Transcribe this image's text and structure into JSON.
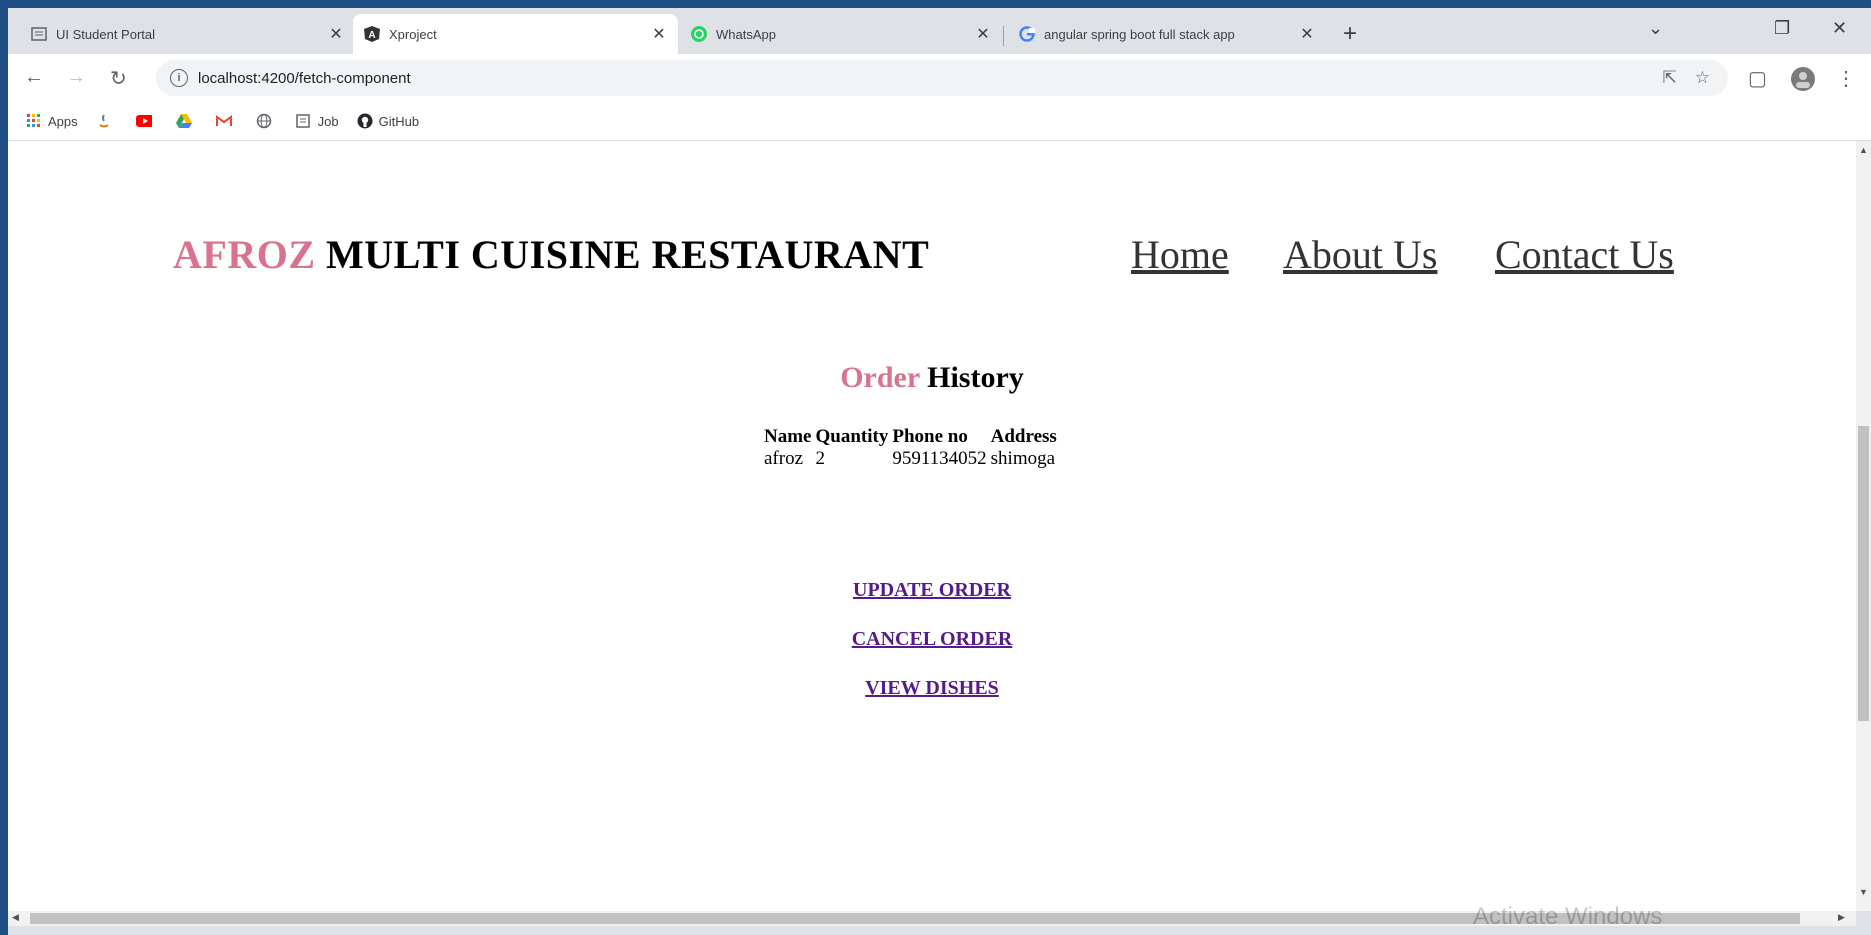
{
  "browser": {
    "tabs": [
      {
        "title": "UI Student Portal",
        "icon": "portal-icon"
      },
      {
        "title": "Xproject",
        "icon": "angular-icon"
      },
      {
        "title": "WhatsApp",
        "icon": "whatsapp-icon"
      },
      {
        "title": "angular spring boot full stack app",
        "icon": "google-icon"
      }
    ],
    "url": "localhost:4200/fetch-component",
    "bookmarks": [
      "Apps",
      "Job",
      "GitHub"
    ]
  },
  "site": {
    "brand_accent": "AFROZ",
    "brand_rest": " MULTI CUISINE RESTAURANT",
    "nav": [
      "Home",
      "About Us",
      "Contact Us"
    ]
  },
  "history": {
    "title_accent": "Order",
    "title_rest": " History",
    "columns": [
      "Name",
      "Quantity",
      "Phone no",
      "Address"
    ],
    "rows": [
      [
        "afroz",
        "2",
        "9591134052",
        "shimoga"
      ]
    ]
  },
  "actions": [
    "UPDATE ORDER",
    "CANCEL ORDER",
    "VIEW DISHES"
  ],
  "watermark": "Activate Windows",
  "colors": {
    "accent": "#d9728f",
    "link": "#551a8b",
    "desktop": "#1f4d85"
  }
}
